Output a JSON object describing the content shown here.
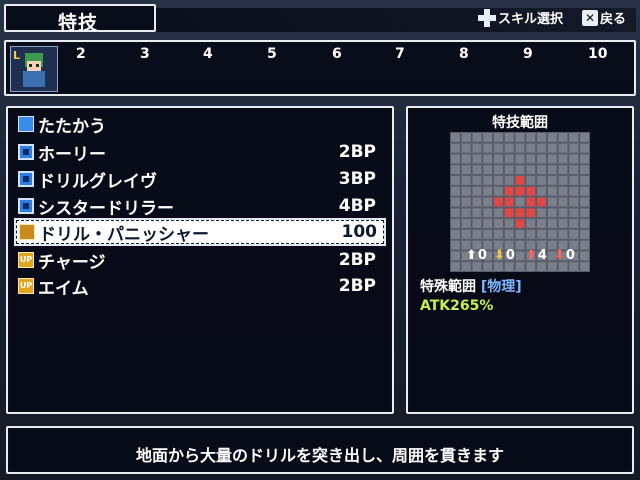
{
  "header": {
    "title": "特技",
    "hint_skill": "スキル選択",
    "hint_back": "戻る"
  },
  "timeline": {
    "ticks": [
      "2",
      "3",
      "4",
      "5",
      "6",
      "7",
      "8",
      "9",
      "10"
    ]
  },
  "skills": [
    {
      "name": "たたかう",
      "cost": "",
      "icon": "sword-icon"
    },
    {
      "name": "ホーリー",
      "cost": "2BP",
      "icon": "magic-icon"
    },
    {
      "name": "ドリルグレイヴ",
      "cost": "3BP",
      "icon": "magic-icon"
    },
    {
      "name": "シスタードリラー",
      "cost": "4BP",
      "icon": "magic-icon"
    },
    {
      "name": "ドリル・パニッシャー",
      "cost": "100",
      "icon": "special-icon"
    },
    {
      "name": "チャージ",
      "cost": "2BP",
      "icon": "buff-icon"
    },
    {
      "name": "エイム",
      "cost": "2BP",
      "icon": "buff-icon"
    }
  ],
  "range": {
    "title": "特技範囲",
    "stats": [
      "0",
      "0",
      "4",
      "0"
    ],
    "range_label": "特殊範囲",
    "type_tag": "[物理]",
    "atk": "ATK265%"
  },
  "description": "地面から大量のドリルを突き出し、周囲を貫きます",
  "colors": {
    "accent": "#e8ecf4",
    "highlight_cell": "#e04848",
    "atk_text": "#c9f04a",
    "type_tag": "#7fb6ff"
  }
}
